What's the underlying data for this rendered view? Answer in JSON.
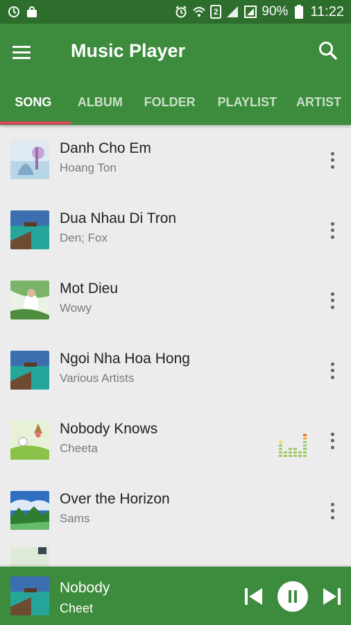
{
  "statusbar": {
    "battery_pct": "90%",
    "time": "11:22",
    "sim_badge": "2"
  },
  "app": {
    "title": "Music Player"
  },
  "tabs": [
    {
      "label": "SONG",
      "active": true
    },
    {
      "label": "ALBUM"
    },
    {
      "label": "FOLDER"
    },
    {
      "label": "PLAYLIST"
    },
    {
      "label": "ARTIST"
    }
  ],
  "songs": [
    {
      "title": "Danh Cho Em",
      "artist": "Hoang Ton"
    },
    {
      "title": "Dua Nhau Di Tron",
      "artist": "Den; Fox"
    },
    {
      "title": "Mot Dieu",
      "artist": "Wowy"
    },
    {
      "title": "Ngoi Nha Hoa Hong",
      "artist": "Various Artists"
    },
    {
      "title": "Nobody Knows",
      "artist": "Cheeta",
      "playing": true
    },
    {
      "title": "Over the Horizon",
      "artist": "Sams"
    }
  ],
  "now_playing": {
    "title": "Nobody",
    "artist": "Cheet"
  },
  "colors": {
    "statusbar": "#2d6e2d",
    "primary": "#3d8b3d",
    "tab_indicator": "#e5405e",
    "background": "#ececec"
  }
}
